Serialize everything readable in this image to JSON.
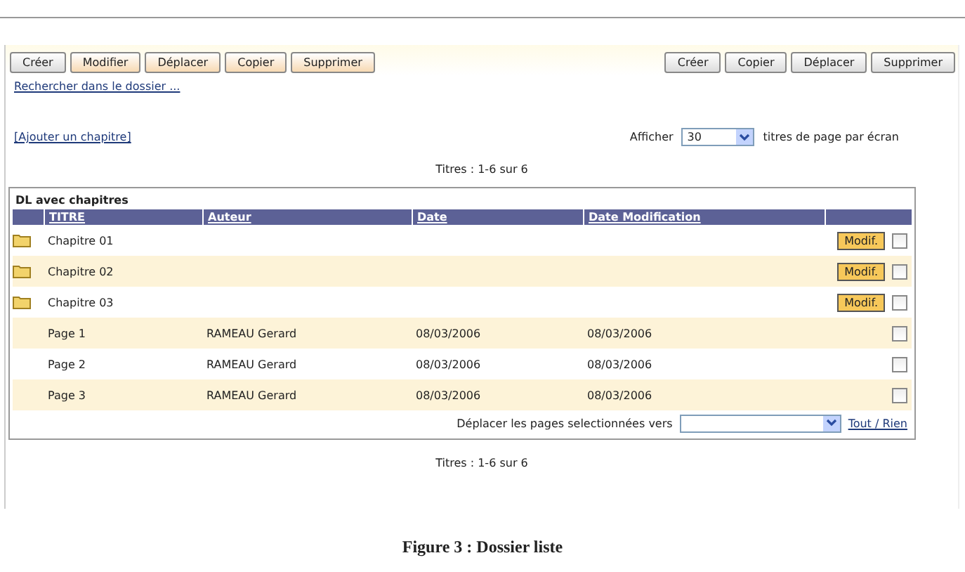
{
  "toolbar_left": [
    {
      "label": "Créer",
      "kind": "plain"
    },
    {
      "label": "Modifier",
      "kind": "accent"
    },
    {
      "label": "Déplacer",
      "kind": "accent"
    },
    {
      "label": "Copier",
      "kind": "accent"
    },
    {
      "label": "Supprimer",
      "kind": "accent"
    }
  ],
  "toolbar_right": [
    {
      "label": "Créer",
      "kind": "plain"
    },
    {
      "label": "Copier",
      "kind": "plain"
    },
    {
      "label": "Déplacer",
      "kind": "plain"
    },
    {
      "label": "Supprimer",
      "kind": "plain"
    }
  ],
  "search_link": "Rechercher dans le dossier ...",
  "add_chapter_link": "[Ajouter un chapitre]",
  "per_page": {
    "prefix": "Afficher",
    "value": "30",
    "suffix": "titres de page par écran"
  },
  "count_top": "Titres : 1-6 sur 6",
  "table": {
    "title": "DL avec chapitres",
    "columns": [
      "TITRE",
      "Auteur",
      "Date",
      "Date Modification"
    ],
    "rows": [
      {
        "kind": "chapter",
        "title": "Chapitre 01",
        "action": "Modif.",
        "checked": false
      },
      {
        "kind": "chapter",
        "title": "Chapitre 02",
        "action": "Modif.",
        "checked": false
      },
      {
        "kind": "chapter",
        "title": "Chapitre 03",
        "action": "Modif.",
        "checked": false
      },
      {
        "kind": "page",
        "title": "Page 1",
        "author": "RAMEAU Gerard",
        "date": "08/03/2006",
        "modified": "08/03/2006",
        "checked": false
      },
      {
        "kind": "page",
        "title": "Page 2",
        "author": "RAMEAU Gerard",
        "date": "08/03/2006",
        "modified": "08/03/2006",
        "checked": false
      },
      {
        "kind": "page",
        "title": "Page 3",
        "author": "RAMEAU Gerard",
        "date": "08/03/2006",
        "modified": "08/03/2006",
        "checked": false
      }
    ],
    "move_label": "Déplacer les pages selectionnées vers",
    "toggle_all": "Tout / Rien"
  },
  "count_bottom": "Titres : 1-6 sur 6",
  "caption": "Figure 3 : Dossier liste"
}
